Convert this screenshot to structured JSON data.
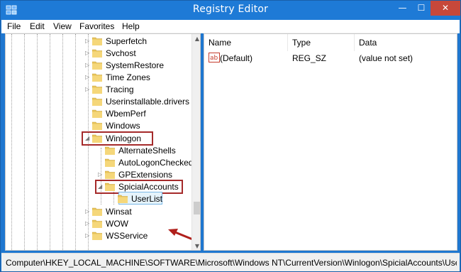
{
  "window": {
    "title": "Registry Editor",
    "close_glyph": "✕",
    "minimize_glyph": "—",
    "maximize_glyph": "☐"
  },
  "menu": [
    "File",
    "Edit",
    "View",
    "Favorites",
    "Help"
  ],
  "tree": {
    "nodes": [
      {
        "label": "Superfetch",
        "expander": "▷"
      },
      {
        "label": "Svchost",
        "expander": "▷"
      },
      {
        "label": "SystemRestore",
        "expander": "▷"
      },
      {
        "label": "Time Zones",
        "expander": "▷"
      },
      {
        "label": "Tracing",
        "expander": "▷"
      },
      {
        "label": "Userinstallable.drivers",
        "expander": ""
      },
      {
        "label": "WbemPerf",
        "expander": ""
      },
      {
        "label": "Windows",
        "expander": ""
      },
      {
        "label": "Winlogon",
        "expander": "◢"
      },
      {
        "label": "AlternateShells",
        "expander": ""
      },
      {
        "label": "AutoLogonChecked",
        "expander": ""
      },
      {
        "label": "GPExtensions",
        "expander": "▷"
      },
      {
        "label": "SpicialAccounts",
        "expander": "◢"
      },
      {
        "label": "UserList",
        "expander": ""
      },
      {
        "label": "Winsat",
        "expander": "▷"
      },
      {
        "label": "WOW",
        "expander": "▷"
      },
      {
        "label": "WSService",
        "expander": "▷"
      }
    ]
  },
  "list": {
    "columns": [
      "Name",
      "Type",
      "Data"
    ],
    "rows": [
      {
        "name": "(Default)",
        "type": "REG_SZ",
        "data": "(value not set)"
      }
    ]
  },
  "status": {
    "path": "Computer\\HKEY_LOCAL_MACHINE\\SOFTWARE\\Microsoft\\Windows NT\\CurrentVersion\\Winlogon\\SpicialAccounts\\UserList"
  },
  "icons": {
    "app": "registry-editor-icon",
    "folder": "folder-icon",
    "value": "string-value-icon",
    "annotation": "red-arrow-icon"
  },
  "colors": {
    "title_bar": "#1e7ad6",
    "close_button": "#c7483a",
    "highlight_box": "#a52a2a",
    "selection": "#e5f3fb",
    "folder": "#e8c45a"
  }
}
